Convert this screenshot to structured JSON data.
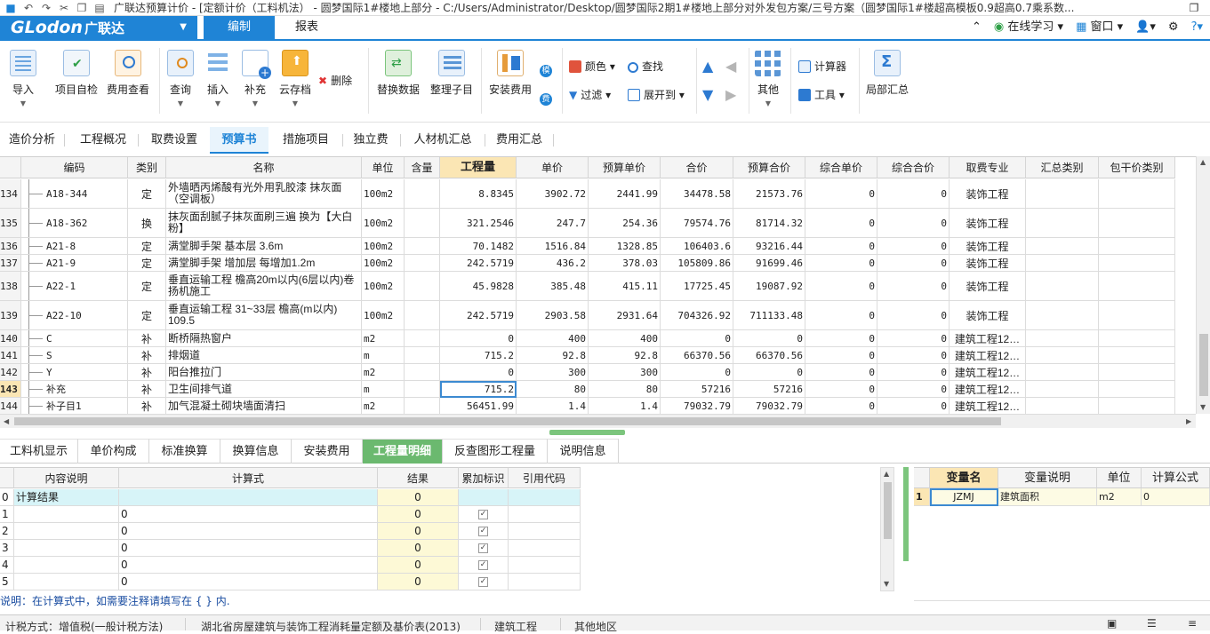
{
  "window": {
    "title": "广联达预算计价 - [定额计价（工料机法） - 圆梦国际1#楼地上部分 - C:/Users/Administrator/Desktop/圆梦国际2期1#楼地上部分对外发包方案/三号方案（圆梦国际1#楼超高模板0.9超高0.7乘系数..."
  },
  "brand": {
    "logo_text": "GLodon",
    "cn": "广联达"
  },
  "menu": {
    "tabs": [
      "编制",
      "报表"
    ],
    "right": {
      "online": "在线学习",
      "window": "窗口"
    }
  },
  "ribbon": {
    "buttons": [
      "导入",
      "项目自检",
      "费用查看",
      "查询",
      "插入",
      "补充",
      "云存档",
      "替换数据",
      "整理子目",
      "安装费用",
      "其他",
      "局部汇总"
    ],
    "small": {
      "delete": "删除",
      "mo": "模",
      "fei": "费",
      "color": "颜色",
      "find": "查找",
      "filter": "过滤",
      "expand": "展开到",
      "calculator": "计算器",
      "tools": "工具"
    }
  },
  "tabs1": [
    "造价分析",
    "工程概况",
    "取费设置",
    "预算书",
    "措施项目",
    "独立费",
    "人材机汇总",
    "费用汇总"
  ],
  "grid": {
    "headers": [
      "编码",
      "类别",
      "名称",
      "单位",
      "含量",
      "工程量",
      "单价",
      "预算单价",
      "合价",
      "预算合价",
      "综合单价",
      "综合合价",
      "取费专业",
      "汇总类别",
      "包干价类别"
    ],
    "rows": [
      [
        "134",
        "A18-344",
        "定",
        "外墙晒丙烯酸有光外用乳胶漆 抹灰面（空调板）",
        "100m2",
        "",
        "8.8345",
        "3902.72",
        "2441.99",
        "34478.58",
        "21573.76",
        "0",
        "0",
        "装饰工程"
      ],
      [
        "135",
        "A18-362",
        "换",
        "抹灰面刮腻子抹灰面刷三遍  换为【大白粉】",
        "100m2",
        "",
        "321.2546",
        "247.7",
        "254.36",
        "79574.76",
        "81714.32",
        "0",
        "0",
        "装饰工程"
      ],
      [
        "136",
        "A21-8",
        "定",
        "满堂脚手架 基本层 3.6m",
        "100m2",
        "",
        "70.1482",
        "1516.84",
        "1328.85",
        "106403.6",
        "93216.44",
        "0",
        "0",
        "装饰工程"
      ],
      [
        "137",
        "A21-9",
        "定",
        "满堂脚手架 增加层 每增加1.2m",
        "100m2",
        "",
        "242.5719",
        "436.2",
        "378.03",
        "105809.86",
        "91699.46",
        "0",
        "0",
        "装饰工程"
      ],
      [
        "138",
        "A22-1",
        "定",
        "垂直运输工程 檐高20m以内(6层以内)卷扬机施工",
        "100m2",
        "",
        "45.9828",
        "385.48",
        "415.11",
        "17725.45",
        "19087.92",
        "0",
        "0",
        "装饰工程"
      ],
      [
        "139",
        "A22-10",
        "定",
        "垂直运输工程 31~33层 檐高(m以内) 109.5",
        "100m2",
        "",
        "242.5719",
        "2903.58",
        "2931.64",
        "704326.92",
        "711133.48",
        "0",
        "0",
        "装饰工程"
      ],
      [
        "140",
        "C",
        "补",
        "断桥隔热窗户",
        "m2",
        "",
        "0",
        "400",
        "400",
        "0",
        "0",
        "0",
        "0",
        "建筑工程12…"
      ],
      [
        "141",
        "S",
        "补",
        "排烟道",
        "m",
        "",
        "715.2",
        "92.8",
        "92.8",
        "66370.56",
        "66370.56",
        "0",
        "0",
        "建筑工程12…"
      ],
      [
        "142",
        "Y",
        "补",
        "阳台推拉门",
        "m2",
        "",
        "0",
        "300",
        "300",
        "0",
        "0",
        "0",
        "0",
        "建筑工程12…"
      ],
      [
        "143",
        "补充",
        "补",
        "卫生间排气道",
        "m",
        "",
        "715.2",
        "80",
        "80",
        "57216",
        "57216",
        "0",
        "0",
        "建筑工程12…"
      ],
      [
        "144",
        "补子目1",
        "补",
        "加气混凝土砌块墙面清扫",
        "m2",
        "",
        "56451.99",
        "1.4",
        "1.4",
        "79032.79",
        "79032.79",
        "0",
        "0",
        "建筑工程12…"
      ]
    ]
  },
  "tabs2": [
    "工料机显示",
    "单价构成",
    "标准换算",
    "换算信息",
    "安装费用",
    "工程量明细",
    "反查图形工程量",
    "说明信息"
  ],
  "detail": {
    "headers": [
      "内容说明",
      "计算式",
      "结果",
      "累加标识",
      "引用代码"
    ],
    "rows": [
      [
        "0",
        "计算结果",
        "",
        "0",
        ""
      ],
      [
        "1",
        "",
        "0",
        "0",
        "✓"
      ],
      [
        "2",
        "",
        "0",
        "0",
        "✓"
      ],
      [
        "3",
        "",
        "0",
        "0",
        "✓"
      ],
      [
        "4",
        "",
        "0",
        "0",
        "✓"
      ],
      [
        "5",
        "",
        "0",
        "0",
        "✓"
      ]
    ],
    "note": "说明：在计算式中，如需要注释请填写在 { } 内."
  },
  "vars": {
    "headers": [
      "变量名",
      "变量说明",
      "单位",
      "计算公式"
    ],
    "row": [
      "1",
      "JZMJ",
      "建筑面积",
      "m2",
      "0"
    ]
  },
  "status": [
    "计税方式：增值税(一般计税方法)",
    "湖北省房屋建筑与装饰工程消耗量定额及基价表(2013)",
    "建筑工程",
    "其他地区"
  ]
}
